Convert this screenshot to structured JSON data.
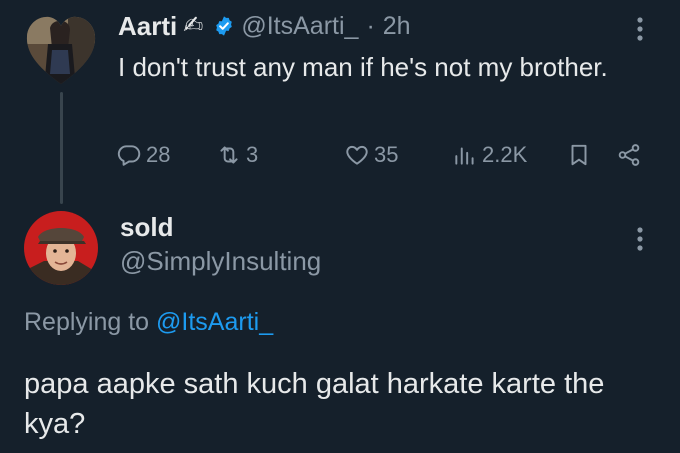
{
  "tweet": {
    "author_name": "Aarti",
    "author_emoji": "✍",
    "handle": "@ItsAarti_",
    "separator": "·",
    "time": "2h",
    "text": "I don't trust any man if he's not my brother.",
    "stats": {
      "replies": "28",
      "retweets": "3",
      "likes": "35",
      "views": "2.2K"
    }
  },
  "reply": {
    "author_name": "sold",
    "handle": "@SimplyInsulting",
    "replying_prefix": "Replying to",
    "replying_to": "@ItsAarti_",
    "text": "papa aapke sath kuch galat harkate karte the kya?"
  },
  "colors": {
    "background": "#15202b",
    "text_primary": "#e7e9ea",
    "text_secondary": "#8b98a5",
    "accent": "#1d9bf0"
  },
  "icons": {
    "more": "more-vertical-icon",
    "verified": "verified-badge-icon",
    "reply": "reply-icon",
    "retweet": "retweet-icon",
    "like": "heart-icon",
    "views": "views-icon",
    "bookmark": "bookmark-icon",
    "share": "share-icon"
  }
}
